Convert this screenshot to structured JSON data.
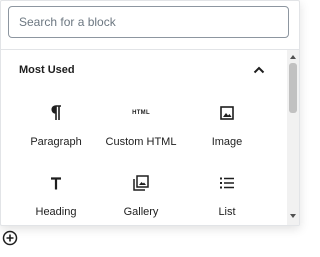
{
  "search": {
    "placeholder": "Search for a block",
    "value": ""
  },
  "section": {
    "title": "Most Used",
    "expanded": true
  },
  "blocks": [
    {
      "label": "Paragraph",
      "icon": "paragraph-icon"
    },
    {
      "label": "Custom HTML",
      "icon": "custom-html-icon",
      "glyph": "HTML"
    },
    {
      "label": "Image",
      "icon": "image-icon"
    },
    {
      "label": "Heading",
      "icon": "heading-icon"
    },
    {
      "label": "Gallery",
      "icon": "gallery-icon"
    },
    {
      "label": "List",
      "icon": "list-icon"
    }
  ],
  "colors": {
    "border": "#e2e4e7",
    "text": "#1e1e1e",
    "placeholder": "#6c7781",
    "scroll_thumb": "#c1c1c1"
  }
}
